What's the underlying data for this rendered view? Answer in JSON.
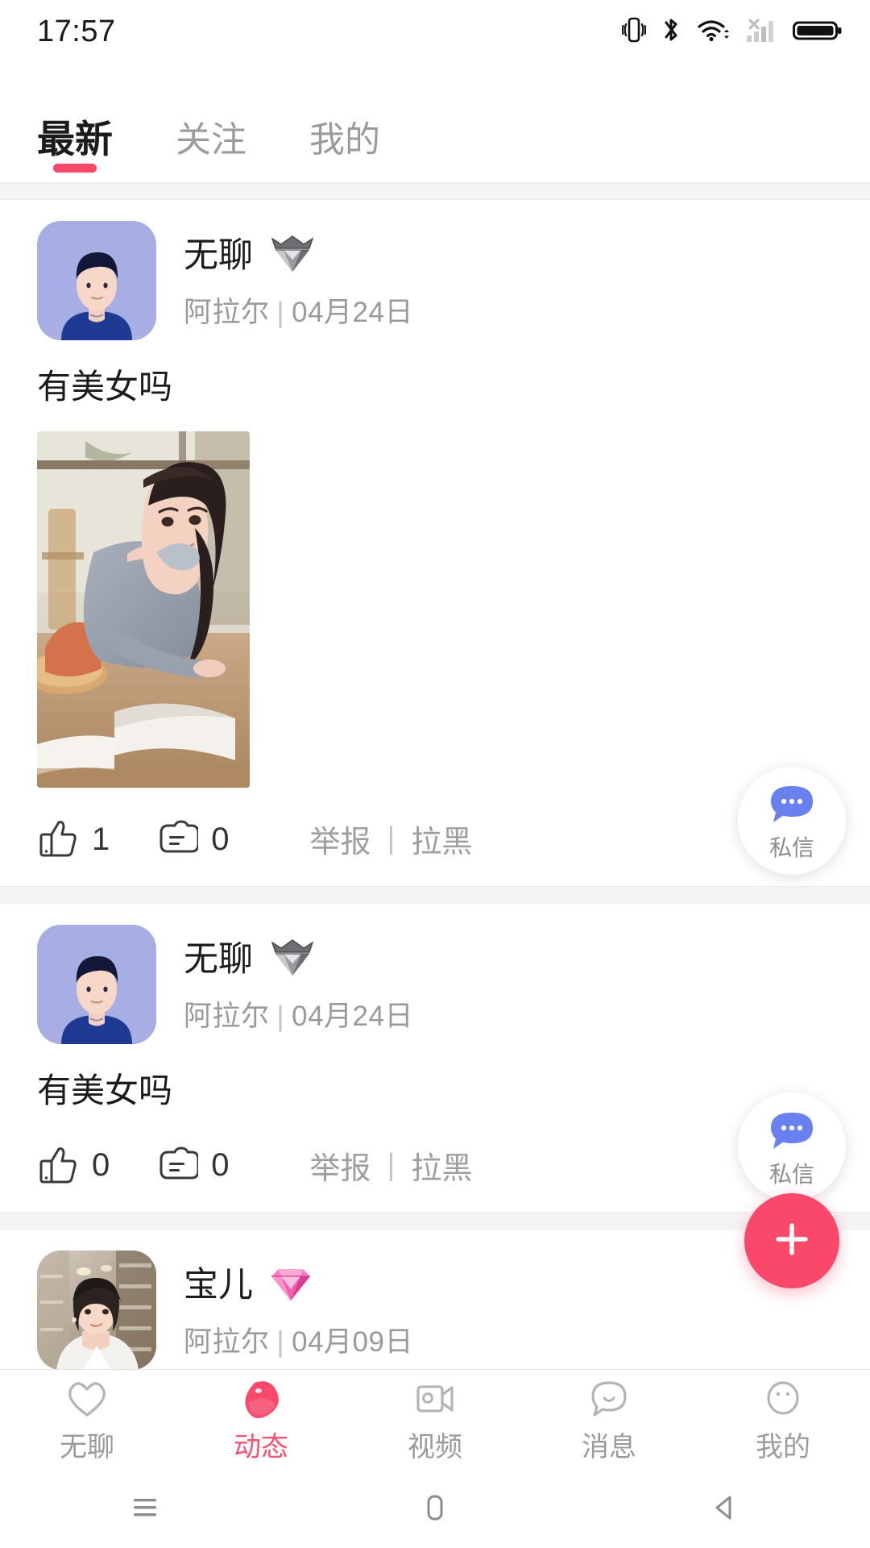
{
  "status_bar": {
    "time": "17:57",
    "icons": [
      "vibrate-icon",
      "bluetooth-icon",
      "wifi-icon",
      "cellular-no-signal-icon",
      "battery-full-icon"
    ]
  },
  "top_tabs": {
    "items": [
      {
        "label": "最新",
        "active": true
      },
      {
        "label": "关注",
        "active": false
      },
      {
        "label": "我的",
        "active": false
      }
    ],
    "indicator_color": "#f94868"
  },
  "feed": {
    "posts": [
      {
        "user_name": "无聊",
        "badge": "silver-crown-diamond-icon",
        "location": "阿拉尔",
        "separator": "|",
        "date": "04月24日",
        "text": "有美女吗",
        "has_image": true,
        "like_count": "1",
        "comment_count": "0",
        "report_label": "举报",
        "report_sep": "|",
        "block_label": "拉黑",
        "pm_label": "私信"
      },
      {
        "user_name": "无聊",
        "badge": "silver-crown-diamond-icon",
        "location": "阿拉尔",
        "separator": "|",
        "date": "04月24日",
        "text": "有美女吗",
        "has_image": false,
        "like_count": "0",
        "comment_count": "0",
        "report_label": "举报",
        "report_sep": "|",
        "block_label": "拉黑",
        "pm_label": "私信"
      },
      {
        "user_name": "宝儿",
        "badge": "pink-diamond-icon",
        "location": "阿拉尔",
        "separator": "|",
        "date": "04月09日",
        "text": "",
        "has_image": false,
        "like_count": "",
        "comment_count": "",
        "report_label": "",
        "report_sep": "",
        "block_label": "",
        "pm_label": ""
      }
    ]
  },
  "fab": {
    "icon": "plus-icon",
    "color": "#f9486a"
  },
  "bottom_nav": {
    "items": [
      {
        "label": "无聊",
        "icon": "heart-icon",
        "active": false
      },
      {
        "label": "动态",
        "icon": "moments-blob-icon",
        "active": true
      },
      {
        "label": "视频",
        "icon": "video-camera-icon",
        "active": false
      },
      {
        "label": "消息",
        "icon": "chat-bubble-icon",
        "active": false
      },
      {
        "label": "我的",
        "icon": "face-icon",
        "active": false
      }
    ],
    "active_color": "#f9546f"
  },
  "system_nav": {
    "buttons": [
      "recents-icon",
      "home-icon",
      "back-icon"
    ]
  }
}
